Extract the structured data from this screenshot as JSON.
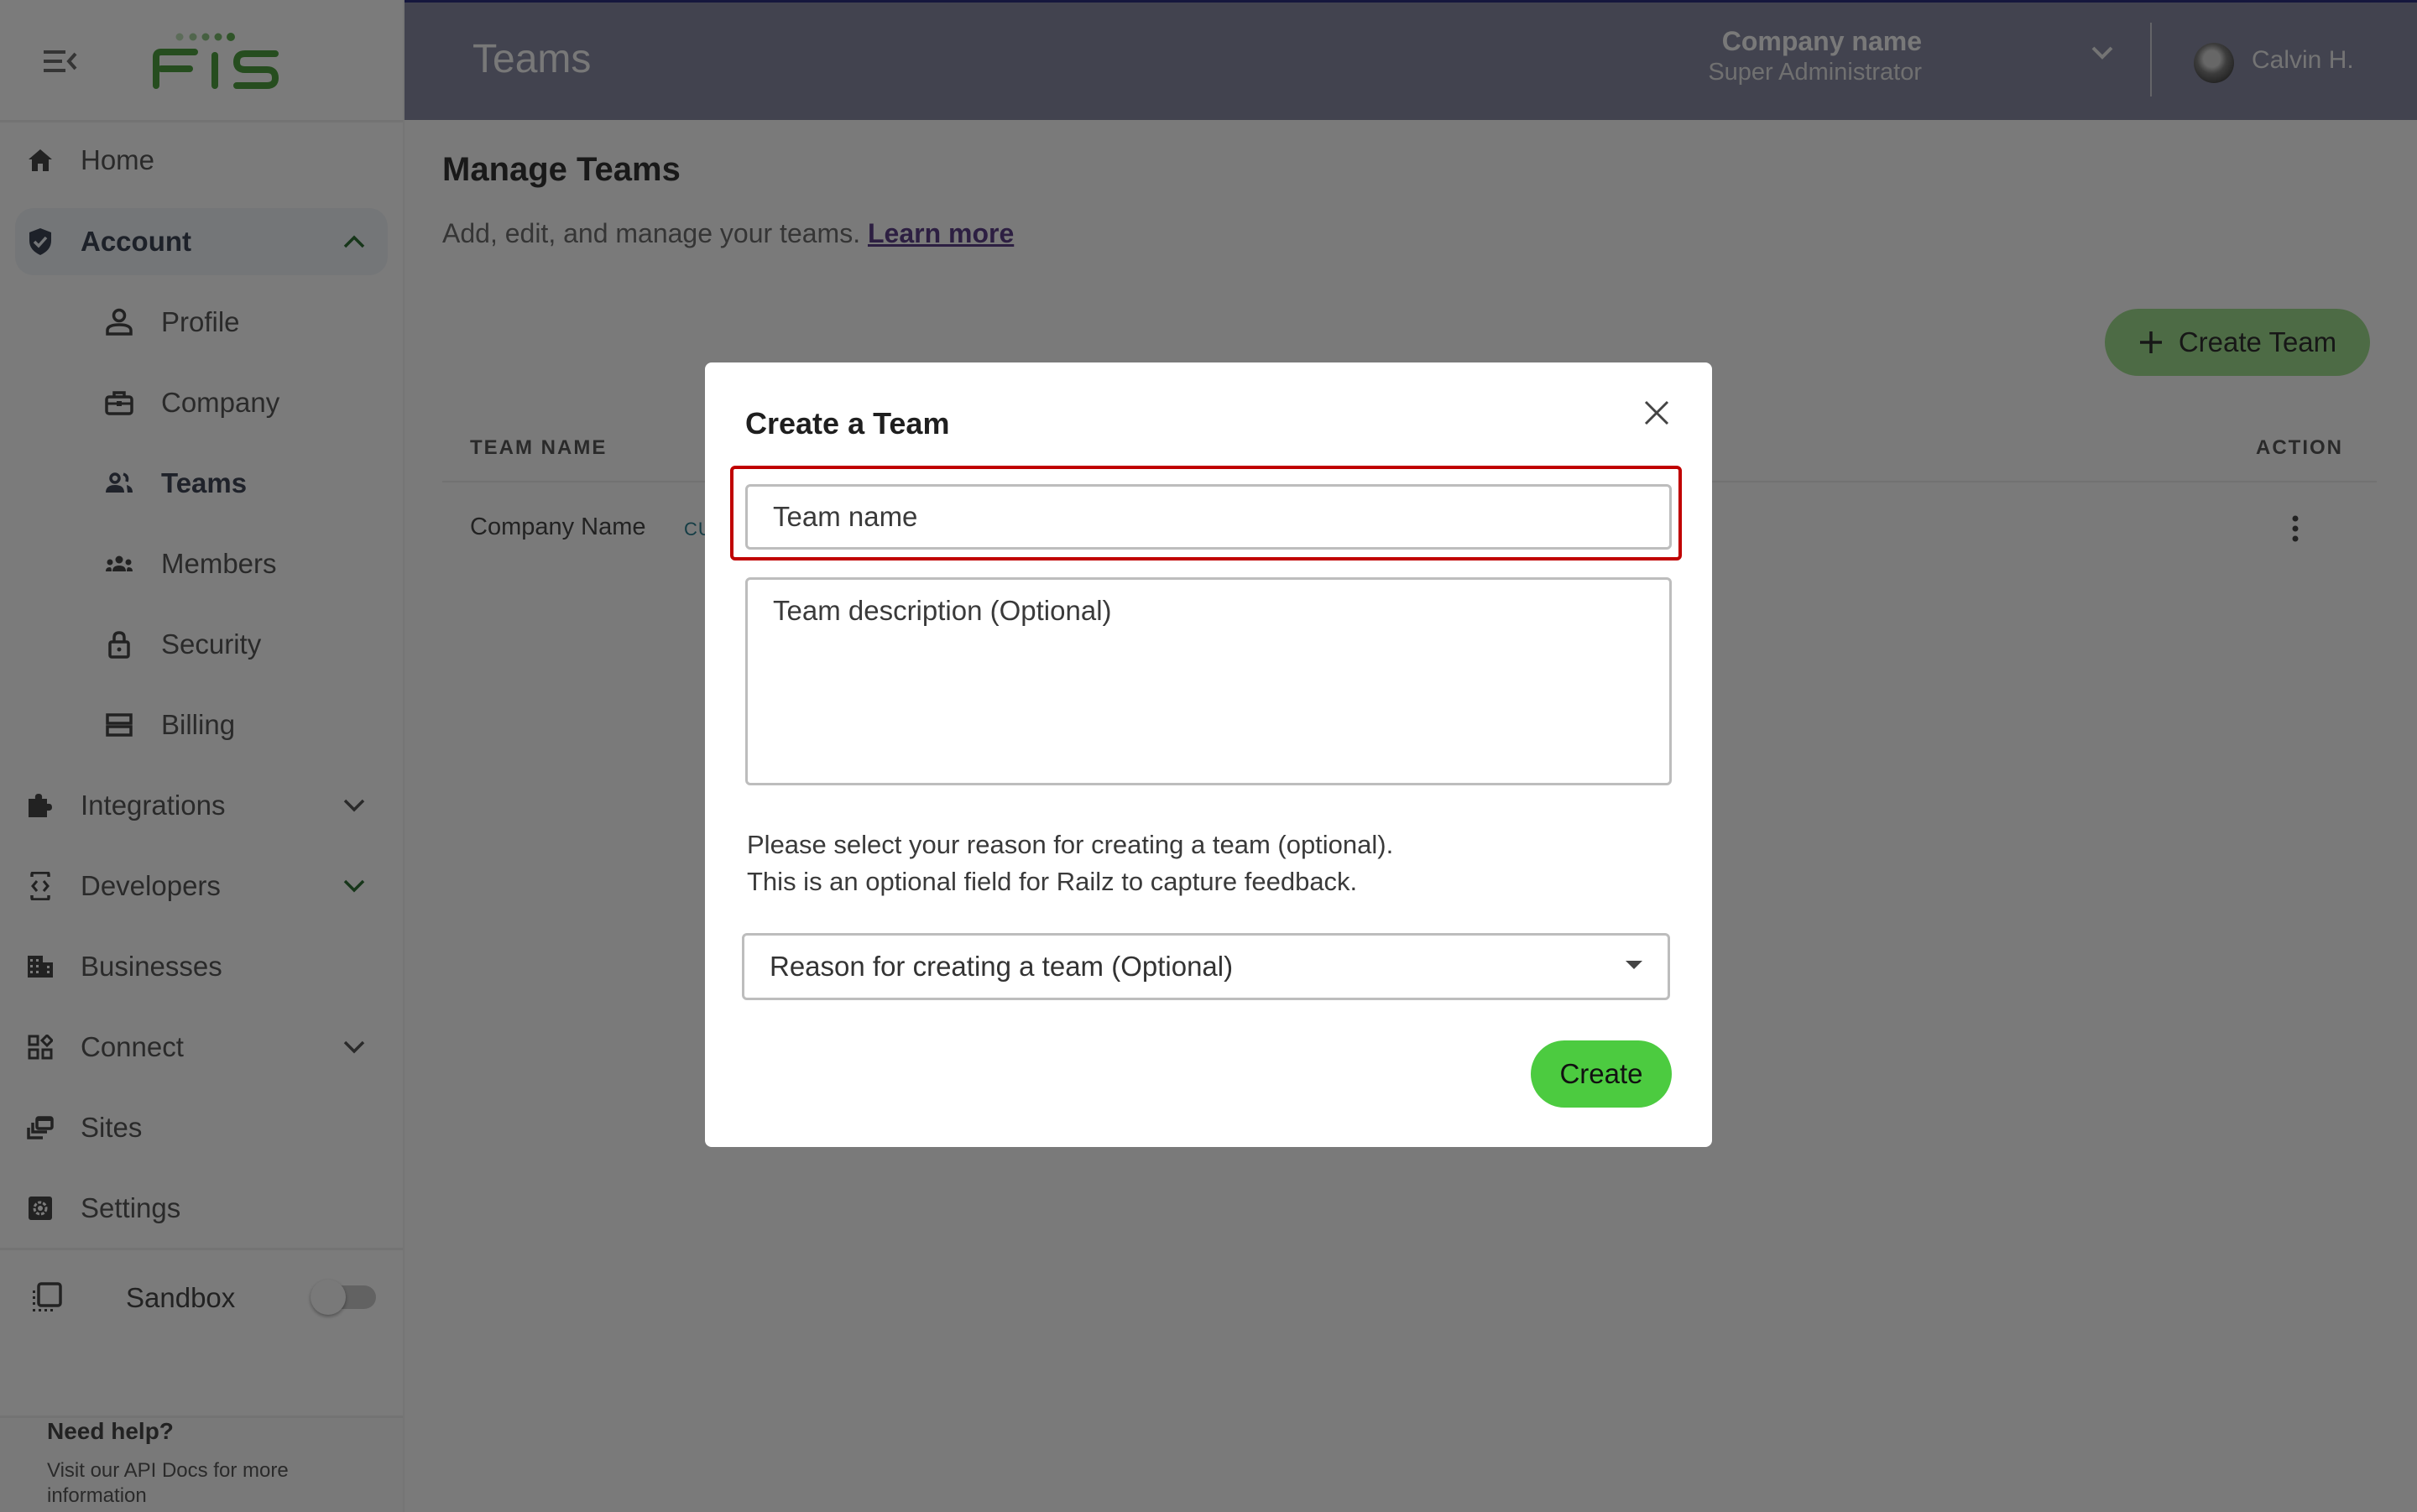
{
  "header": {
    "page_title": "Teams",
    "company_name": "Company name",
    "company_role": "Super Administrator",
    "user_name": "Calvin H."
  },
  "brand": {
    "logo_text": "FIS",
    "accent": "#4c9a3f"
  },
  "sidebar": {
    "items": [
      {
        "id": "home",
        "label": "Home",
        "icon": "home-icon"
      },
      {
        "id": "account",
        "label": "Account",
        "icon": "shield-check-icon",
        "expanded": true
      },
      {
        "id": "profile",
        "label": "Profile",
        "icon": "person-icon"
      },
      {
        "id": "company",
        "label": "Company",
        "icon": "briefcase-icon"
      },
      {
        "id": "teams",
        "label": "Teams",
        "icon": "team-icon",
        "current": true
      },
      {
        "id": "members",
        "label": "Members",
        "icon": "group-icon"
      },
      {
        "id": "security",
        "label": "Security",
        "icon": "lock-icon"
      },
      {
        "id": "billing",
        "label": "Billing",
        "icon": "billing-icon"
      },
      {
        "id": "integrations",
        "label": "Integrations",
        "icon": "puzzle-icon"
      },
      {
        "id": "developers",
        "label": "Developers",
        "icon": "code-icon"
      },
      {
        "id": "businesses",
        "label": "Businesses",
        "icon": "building-icon"
      },
      {
        "id": "connect",
        "label": "Connect",
        "icon": "widgets-icon"
      },
      {
        "id": "sites",
        "label": "Sites",
        "icon": "sites-icon"
      },
      {
        "id": "settings",
        "label": "Settings",
        "icon": "settings-icon"
      }
    ],
    "sandbox_label": "Sandbox",
    "sandbox_enabled": false,
    "help_title": "Need help?",
    "help_text": "Visit our API Docs for more information"
  },
  "main": {
    "heading": "Manage Teams",
    "subtitle": "Add, edit, and manage your teams.",
    "learn_more": "Learn more",
    "create_team_label": "Create Team",
    "table": {
      "columns": [
        "TEAM NAME",
        "ACTION"
      ],
      "rows": [
        {
          "team_name": "Company Name",
          "badge": "CU"
        }
      ]
    }
  },
  "modal": {
    "title": "Create a Team",
    "team_name_placeholder": "Team name",
    "team_name_value": "",
    "description_placeholder": "Team description (Optional)",
    "description_value": "",
    "help_line1": "Please select your reason for creating a team (optional).",
    "help_line2": "This is an optional field for Railz to capture feedback.",
    "reason_selected": "Reason for creating a team (Optional)",
    "create_label": "Create",
    "highlight_color": "#c00000",
    "create_color": "#4ccb40"
  }
}
